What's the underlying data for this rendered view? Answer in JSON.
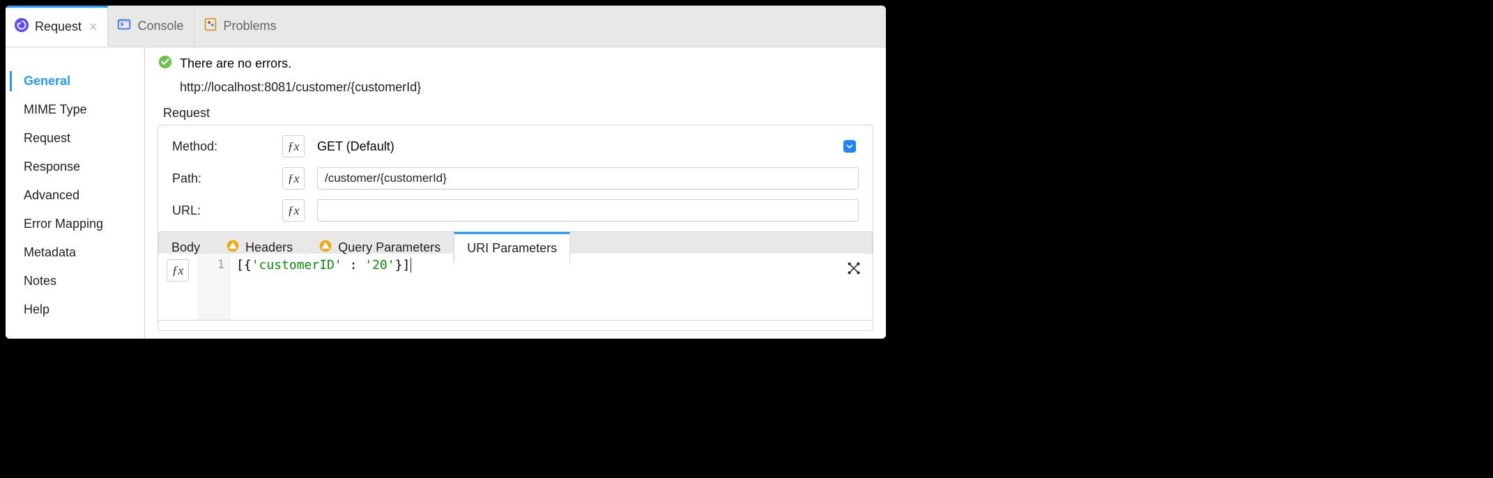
{
  "top_tabs": {
    "request": {
      "label": "Request"
    },
    "console": {
      "label": "Console"
    },
    "problems": {
      "label": "Problems"
    }
  },
  "sidebar": {
    "items": [
      {
        "label": "General"
      },
      {
        "label": "MIME Type"
      },
      {
        "label": "Request"
      },
      {
        "label": "Response"
      },
      {
        "label": "Advanced"
      },
      {
        "label": "Error Mapping"
      },
      {
        "label": "Metadata"
      },
      {
        "label": "Notes"
      },
      {
        "label": "Help"
      }
    ]
  },
  "status_text": "There are no errors.",
  "url_display": "http://localhost:8081/customer/{customerId}",
  "group_title": "Request",
  "form": {
    "method_label": "Method:",
    "method_value": "GET (Default)",
    "path_label": "Path:",
    "path_value": "/customer/{customerId}",
    "url_label": "URL:",
    "url_value": ""
  },
  "inner_tabs": {
    "body": "Body",
    "headers": "Headers",
    "query": "Query Parameters",
    "uri": "URI Parameters"
  },
  "code": {
    "line_number": "1",
    "raw": "[{'customerID' : '20'}]"
  }
}
